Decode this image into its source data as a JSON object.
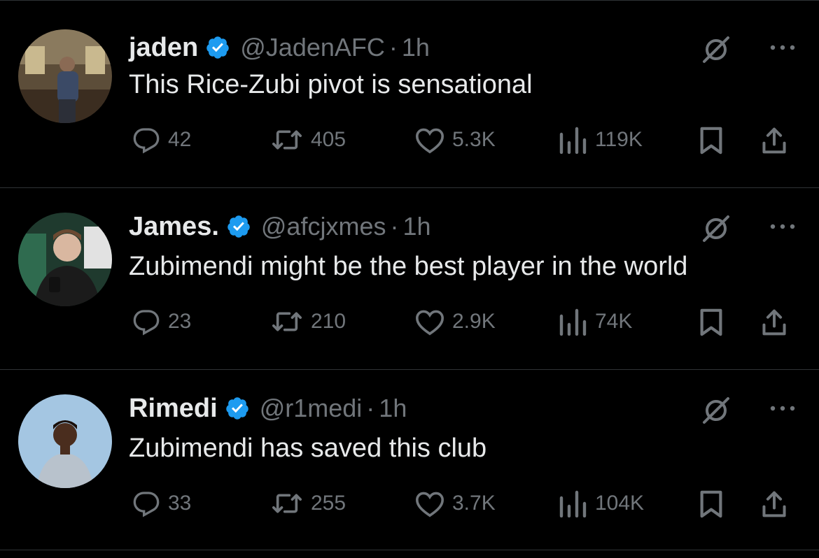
{
  "tweets": [
    {
      "name": "jaden",
      "handle": "@JadenAFC",
      "sep": "·",
      "time": "1h",
      "text": "This Rice-Zubi pivot is sensational",
      "replies": "42",
      "reposts": "405",
      "likes": "5.3K",
      "views": "119K",
      "avatar_colors": [
        "#7a6a52",
        "#3e3428"
      ]
    },
    {
      "name": "James.",
      "handle": "@afcjxmes",
      "sep": "·",
      "time": "1h",
      "text": "Zubimendi might be the best player in the world",
      "replies": "23",
      "reposts": "210",
      "likes": "2.9K",
      "views": "74K",
      "avatar_colors": [
        "#2e5a44",
        "#1a1a1a"
      ]
    },
    {
      "name": "Rimedi",
      "handle": "@r1medi",
      "sep": "·",
      "time": "1h",
      "text": "Zubimendi has saved this club",
      "replies": "33",
      "reposts": "255",
      "likes": "3.7K",
      "views": "104K",
      "avatar_colors": [
        "#a9cbe6",
        "#8ab0d3"
      ]
    }
  ],
  "colors": {
    "background": "#000000",
    "text": "#e7e9ea",
    "muted": "#71767b",
    "verified": "#1d9bf0",
    "divider": "#2f3336"
  },
  "icons": [
    "verified-badge-icon",
    "grok-icon",
    "more-icon",
    "reply-icon",
    "repost-icon",
    "like-icon",
    "views-icon",
    "bookmark-icon",
    "share-icon"
  ]
}
